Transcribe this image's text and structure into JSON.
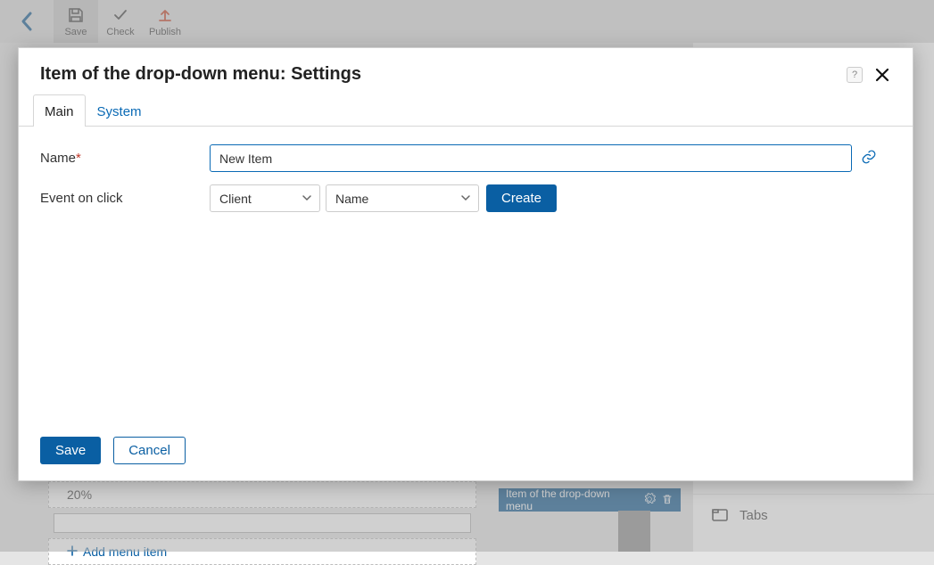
{
  "toolbar": {
    "save_label": "Save",
    "check_label": "Check",
    "publish_label": "Publish"
  },
  "background": {
    "percent_text": "20%",
    "add_menu_label": "Add menu item",
    "selected_caption": "Item of the drop-down menu",
    "rp_tabs_label": "Tabs"
  },
  "dialog": {
    "title": "Item of the drop-down menu: Settings",
    "help_symbol": "?",
    "tabs": {
      "main": "Main",
      "system": "System"
    },
    "fields": {
      "name_label": "Name",
      "name_value": "New Item",
      "event_label": "Event on click",
      "event_scope": "Client",
      "event_target": "Name",
      "create_btn": "Create"
    },
    "footer": {
      "save": "Save",
      "cancel": "Cancel"
    }
  }
}
